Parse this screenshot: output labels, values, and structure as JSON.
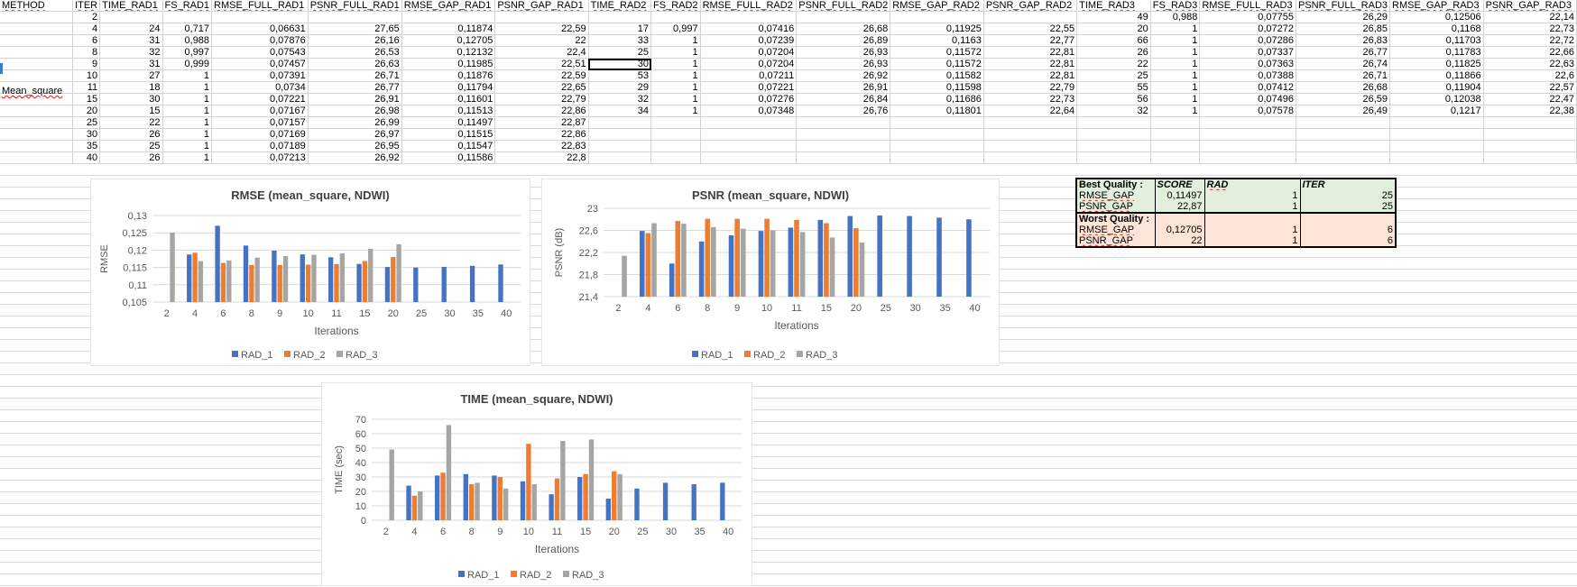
{
  "sheet": {
    "headers": [
      "METHOD",
      "ITER",
      "TIME_RAD1",
      "FS_RAD1",
      "RMSE_FULL_RAD1",
      "PSNR_FULL_RAD1",
      "RMSE_GAP_RAD1",
      "PSNR_GAP_RAD1",
      "TIME_RAD2",
      "FS_RAD2",
      "RMSE_FULL_RAD2",
      "PSNR_FULL_RAD2",
      "RMSE_GAP_RAD2",
      "PSNR_GAP_RAD2",
      "TIME_RAD3",
      "FS_RAD3",
      "RMSE_FULL_RAD3",
      "PSNR_FULL_RAD3",
      "RMSE_GAP_RAD3",
      "PSNR_GAP_RAD3"
    ],
    "method_label": "Mean_square",
    "rows": [
      [
        "",
        "2",
        "",
        "",
        "",
        "",
        "",
        "",
        "",
        "",
        "",
        "",
        "",
        "",
        "49",
        "0,988",
        "0,07755",
        "26,29",
        "0,12506",
        "22,14"
      ],
      [
        "",
        "4",
        "24",
        "0,717",
        "0,06631",
        "27,65",
        "0,11874",
        "22,59",
        "17",
        "0,997",
        "0,07416",
        "26,68",
        "0,11925",
        "22,55",
        "20",
        "1",
        "0,07272",
        "26,85",
        "0,1168",
        "22,73"
      ],
      [
        "",
        "6",
        "31",
        "0,988",
        "0,07876",
        "26,16",
        "0,12705",
        "22",
        "33",
        "1",
        "0,07239",
        "26,89",
        "0,1163",
        "22,77",
        "66",
        "1",
        "0,07286",
        "26,83",
        "0,11703",
        "22,72"
      ],
      [
        "",
        "8",
        "32",
        "0,997",
        "0,07543",
        "26,53",
        "0,12132",
        "22,4",
        "25",
        "1",
        "0,07204",
        "26,93",
        "0,11572",
        "22,81",
        "26",
        "1",
        "0,07337",
        "26,77",
        "0,11783",
        "22,66"
      ],
      [
        "",
        "9",
        "31",
        "0,999",
        "0,07457",
        "26,63",
        "0,11985",
        "22,51",
        "30",
        "1",
        "0,07204",
        "26,93",
        "0,11572",
        "22,81",
        "22",
        "1",
        "0,07363",
        "26,74",
        "0,11825",
        "22,63"
      ],
      [
        "",
        "10",
        "27",
        "1",
        "0,07391",
        "26,71",
        "0,11876",
        "22,59",
        "53",
        "1",
        "0,07211",
        "26,92",
        "0,11582",
        "22,81",
        "25",
        "1",
        "0,07388",
        "26,71",
        "0,11866",
        "22,6"
      ],
      [
        "",
        "11",
        "18",
        "1",
        "0,0734",
        "26,77",
        "0,11794",
        "22,65",
        "29",
        "1",
        "0,07221",
        "26,91",
        "0,11598",
        "22,79",
        "55",
        "1",
        "0,07412",
        "26,68",
        "0,11904",
        "22,57"
      ],
      [
        "",
        "15",
        "30",
        "1",
        "0,07221",
        "26,91",
        "0,11601",
        "22,79",
        "32",
        "1",
        "0,07276",
        "26,84",
        "0,11686",
        "22,73",
        "56",
        "1",
        "0,07496",
        "26,59",
        "0,12038",
        "22,47"
      ],
      [
        "",
        "20",
        "15",
        "1",
        "0,07167",
        "26,98",
        "0,11513",
        "22,86",
        "34",
        "1",
        "0,07348",
        "26,76",
        "0,11801",
        "22,64",
        "32",
        "1",
        "0,07578",
        "26,49",
        "0,1217",
        "22,38"
      ],
      [
        "",
        "25",
        "22",
        "1",
        "0,07157",
        "26,99",
        "0,11497",
        "22,87",
        "",
        "",
        "",
        "",
        "",
        "",
        "",
        "",
        "",
        "",
        "",
        ""
      ],
      [
        "",
        "30",
        "26",
        "1",
        "0,07169",
        "26,97",
        "0,11515",
        "22,86",
        "",
        "",
        "",
        "",
        "",
        "",
        "",
        "",
        "",
        "",
        "",
        ""
      ],
      [
        "",
        "35",
        "25",
        "1",
        "0,07189",
        "26,95",
        "0,11547",
        "22,83",
        "",
        "",
        "",
        "",
        "",
        "",
        "",
        "",
        "",
        "",
        "",
        ""
      ],
      [
        "",
        "40",
        "26",
        "1",
        "0,07213",
        "26,92",
        "0,11586",
        "22,8",
        "",
        "",
        "",
        "",
        "",
        "",
        "",
        "",
        "",
        "",
        "",
        ""
      ]
    ]
  },
  "quality": {
    "best_label": "Best Quality :",
    "worst_label": "Worst Quality :",
    "col_score": "SCORE",
    "col_rad": "RAD",
    "col_iter": "ITER",
    "best": [
      {
        "metric": "RMSE_GAP",
        "score": "0,11497",
        "rad": "1",
        "iter": "25"
      },
      {
        "metric": "PSNR_GAP",
        "score": "22,87",
        "rad": "1",
        "iter": "25"
      }
    ],
    "worst": [
      {
        "metric": "RMSE_GAP",
        "score": "0,12705",
        "rad": "1",
        "iter": "6"
      },
      {
        "metric": "PSNR_GAP",
        "score": "22",
        "rad": "1",
        "iter": "6"
      }
    ]
  },
  "colors": {
    "rad1": "#4472c4",
    "rad2": "#ed7d31",
    "rad3": "#a5a5a5",
    "grid": "#d9d9d9",
    "best_fill": "#e2efda",
    "worst_fill": "#fce4d6"
  },
  "chart_data": [
    {
      "type": "bar",
      "title": "RMSE (mean_square, NDWI)",
      "xlabel": "Iterations",
      "ylabel": "RMSE",
      "categories": [
        "2",
        "4",
        "6",
        "8",
        "9",
        "10",
        "11",
        "15",
        "20",
        "25",
        "30",
        "35",
        "40"
      ],
      "ylim": [
        0.105,
        0.13
      ],
      "yticks": [
        "0,105",
        "0,11",
        "0,115",
        "0,12",
        "0,125",
        "0,13"
      ],
      "ytick_values": [
        0.105,
        0.11,
        0.115,
        0.12,
        0.125,
        0.13
      ],
      "series": [
        {
          "name": "RAD_1",
          "values": [
            null,
            0.11874,
            0.12705,
            0.12132,
            0.11985,
            0.11876,
            0.11794,
            0.11601,
            0.11513,
            0.11497,
            0.11515,
            0.11547,
            0.11586
          ]
        },
        {
          "name": "RAD_2",
          "values": [
            null,
            0.11925,
            0.1163,
            0.11572,
            0.11572,
            0.11582,
            0.11598,
            0.11686,
            0.11801,
            null,
            null,
            null,
            null
          ]
        },
        {
          "name": "RAD_3",
          "values": [
            0.12506,
            0.1168,
            0.11703,
            0.11783,
            0.11825,
            0.11866,
            0.11904,
            0.12038,
            0.1217,
            null,
            null,
            null,
            null
          ]
        }
      ],
      "legend": "bottom"
    },
    {
      "type": "bar",
      "title": "PSNR (mean_square, NDWI)",
      "xlabel": "Iterations",
      "ylabel": "PSNR (dB)",
      "categories": [
        "2",
        "4",
        "6",
        "8",
        "9",
        "10",
        "11",
        "15",
        "20",
        "25",
        "30",
        "35",
        "40"
      ],
      "ylim": [
        21.4,
        23
      ],
      "yticks": [
        "21,4",
        "21,8",
        "22,2",
        "22,6",
        "23"
      ],
      "ytick_values": [
        21.4,
        21.8,
        22.2,
        22.6,
        23
      ],
      "series": [
        {
          "name": "RAD_1",
          "values": [
            null,
            22.59,
            22,
            22.4,
            22.51,
            22.59,
            22.65,
            22.79,
            22.86,
            22.87,
            22.86,
            22.83,
            22.8
          ]
        },
        {
          "name": "RAD_2",
          "values": [
            null,
            22.55,
            22.77,
            22.81,
            22.81,
            22.81,
            22.79,
            22.73,
            22.64,
            null,
            null,
            null,
            null
          ]
        },
        {
          "name": "RAD_3",
          "values": [
            22.14,
            22.73,
            22.72,
            22.66,
            22.63,
            22.6,
            22.57,
            22.47,
            22.38,
            null,
            null,
            null,
            null
          ]
        }
      ],
      "legend": "bottom"
    },
    {
      "type": "bar",
      "title": "TIME (mean_square, NDWI)",
      "xlabel": "Iterations",
      "ylabel": "TIME (sec)",
      "categories": [
        "2",
        "4",
        "6",
        "8",
        "9",
        "10",
        "11",
        "15",
        "20",
        "25",
        "30",
        "35",
        "40"
      ],
      "ylim": [
        0,
        70
      ],
      "yticks": [
        "0",
        "10",
        "20",
        "30",
        "40",
        "50",
        "60",
        "70"
      ],
      "ytick_values": [
        0,
        10,
        20,
        30,
        40,
        50,
        60,
        70
      ],
      "series": [
        {
          "name": "RAD_1",
          "values": [
            null,
            24,
            31,
            32,
            31,
            27,
            18,
            30,
            15,
            22,
            26,
            25,
            26
          ]
        },
        {
          "name": "RAD_2",
          "values": [
            null,
            17,
            33,
            25,
            30,
            53,
            29,
            32,
            34,
            null,
            null,
            null,
            null
          ]
        },
        {
          "name": "RAD_3",
          "values": [
            49,
            20,
            66,
            26,
            22,
            25,
            55,
            56,
            32,
            null,
            null,
            null,
            null
          ]
        }
      ],
      "legend": "bottom"
    }
  ]
}
